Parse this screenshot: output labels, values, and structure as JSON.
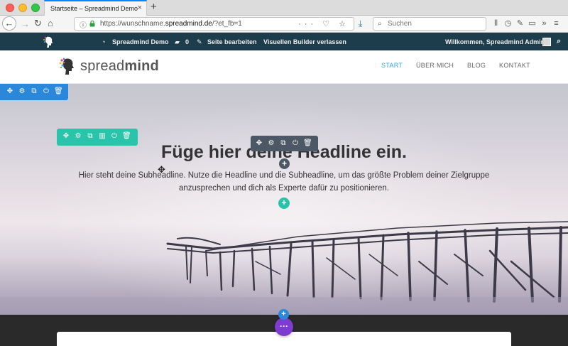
{
  "browser": {
    "tab_title": "Startseite – Spreadmind Demo",
    "tab_close": "×",
    "new_tab": "+",
    "url_scheme": "https://wunschname.",
    "url_domain": "spreadmind.de",
    "url_path": "/?et_fb=1",
    "url_actions": "··· ♡ ☆",
    "search_placeholder": "Suchen",
    "toolbar_icons": [
      "library-icon",
      "history-icon",
      "pen-icon",
      "sidebar-icon",
      "overflow-icon",
      "menu-icon"
    ]
  },
  "adminbar": {
    "site_name": "Spreadmind Demo",
    "comments_count": "0",
    "edit_page": "Seite bearbeiten",
    "exit_builder": "Visuellen Builder verlassen",
    "greeting": "Willkommen, Spreadmind Admin"
  },
  "site": {
    "brand_regular": "spread",
    "brand_bold": "mind",
    "nav": [
      "START",
      "ÜBER MICH",
      "BLOG",
      "KONTAKT"
    ],
    "active_nav": "START"
  },
  "hero": {
    "headline": "Füge hier deine Headline ein.",
    "subheadline": "Hier steht deine Subheadline. Nutze die Headline und die Subheadline, um das größte Problem deiner Zielgruppe anzusprechen und dich als Experte dafür zu positionieren."
  },
  "builder": {
    "section_color": "#2b87da",
    "row_color": "#29c4a9",
    "module_color": "#4c5866",
    "page_settings_color": "#7e3bd0",
    "add_label": "+",
    "settings_label": "···"
  }
}
